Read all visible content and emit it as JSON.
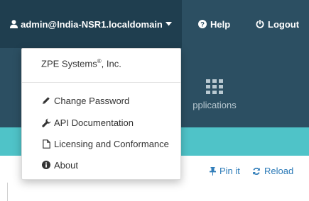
{
  "header": {
    "user_label": "admin@India-NSR1.localdomain",
    "help_label": "Help",
    "logout_label": "Logout"
  },
  "apps_tile": {
    "label": "pplications"
  },
  "dropdown": {
    "company": "ZPE Systems",
    "company_mark": "®",
    "company_suffix": ", Inc.",
    "items": [
      {
        "label": "Change Password",
        "icon": "pencil-icon"
      },
      {
        "label": "API Documentation",
        "icon": "wrench-icon"
      },
      {
        "label": "Licensing and Conformance",
        "icon": "document-icon"
      },
      {
        "label": "About",
        "icon": "info-circle-icon"
      }
    ]
  },
  "actions": {
    "pin_label": "Pin it",
    "reload_label": "Reload"
  },
  "colors": {
    "header_bg": "#2c4f62",
    "user_toggle_bg": "#1f3e4f",
    "teal_bar": "#4fc3c8",
    "link_blue": "#2d7bb8"
  }
}
